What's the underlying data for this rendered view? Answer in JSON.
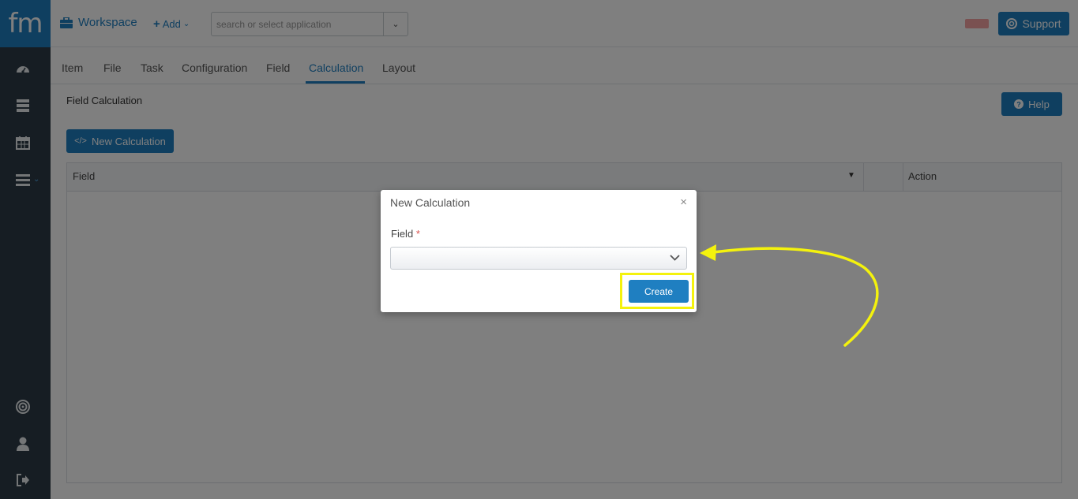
{
  "app": {
    "logo_text": "fm",
    "workspace_label": "Workspace",
    "add_label": "Add",
    "search_placeholder": "search or select application",
    "support_label": "Support"
  },
  "tabs": [
    {
      "label": "Item"
    },
    {
      "label": "File"
    },
    {
      "label": "Task"
    },
    {
      "label": "Configuration"
    },
    {
      "label": "Field"
    },
    {
      "label": "Calculation",
      "active": true
    },
    {
      "label": "Layout"
    }
  ],
  "page": {
    "section_title": "Field Calculation",
    "help_label": "Help",
    "new_calc_label": "New Calculation",
    "table": {
      "col_field": "Field",
      "col_action": "Action"
    }
  },
  "modal": {
    "title": "New Calculation",
    "field_label": "Field",
    "required_marker": "*",
    "field_value": "",
    "create_label": "Create"
  },
  "sidebar_icons": [
    "dashboard-icon",
    "server-icon",
    "calendar-icon",
    "menu-icon",
    "target-icon",
    "user-icon",
    "sign-out-icon"
  ],
  "colors": {
    "primary": "#1f7fc1",
    "sidebar": "#2c3b47",
    "highlight": "#f4f20d"
  }
}
